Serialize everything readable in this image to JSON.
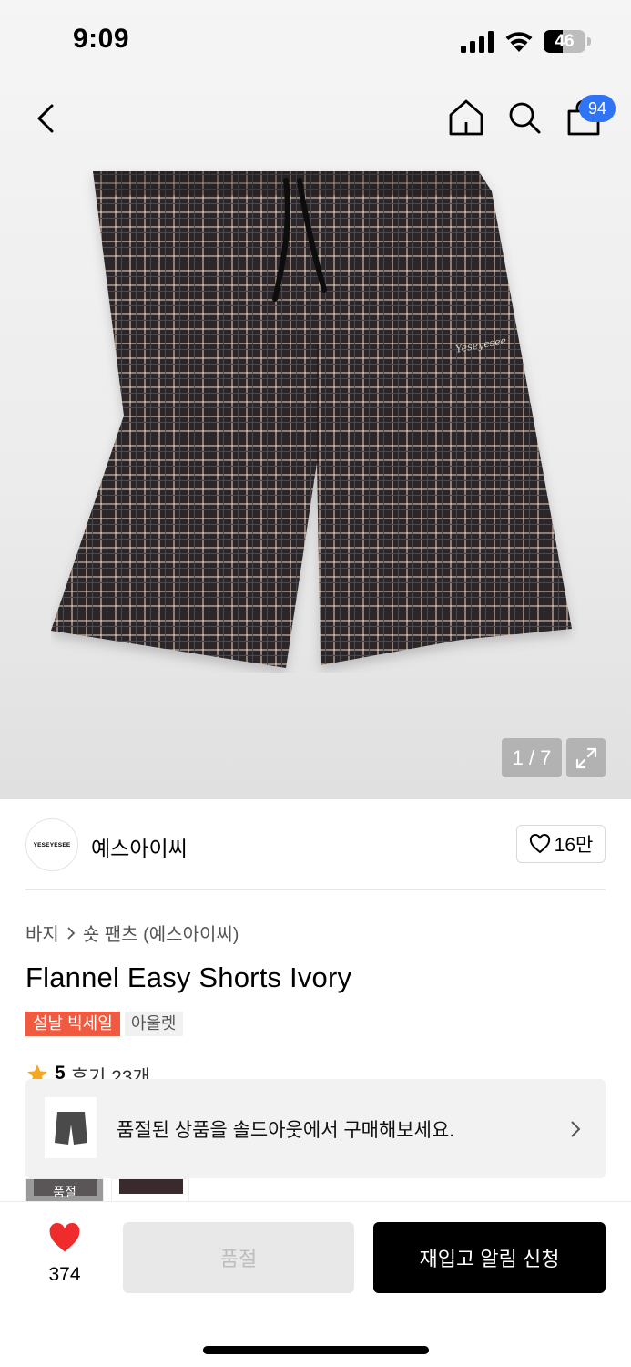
{
  "status_bar": {
    "time": "9:09",
    "battery": "46",
    "battery_level": 0.46
  },
  "header": {
    "cart_count": "94"
  },
  "gallery": {
    "counter": "1 / 7",
    "product_logo_text": "Yeseyesee"
  },
  "brand": {
    "logo_text": "YESEYESEE",
    "name": "예스아이씨",
    "likes": "16만"
  },
  "breadcrumb": {
    "category": "바지",
    "sub_category": "숏 팬츠 (예스아이씨)"
  },
  "product": {
    "title": "Flannel Easy Shorts Ivory",
    "tags": [
      "설날 빅세일",
      "아울렛"
    ],
    "rating": "5",
    "reviews": "후기 23개"
  },
  "toast": {
    "message": "품절된 상품을 솔드아웃에서 구매해보세요."
  },
  "thumbs": {
    "sold_label": "품절"
  },
  "bottom_bar": {
    "like_count": "374",
    "soldout_label": "품절",
    "restock_label": "재입고 알림 신청"
  },
  "colors": {
    "badge_blue": "#2f74f5",
    "sale_red": "#f05a40",
    "heart_red": "#ef2b2b",
    "star_orange": "#f5a623"
  }
}
